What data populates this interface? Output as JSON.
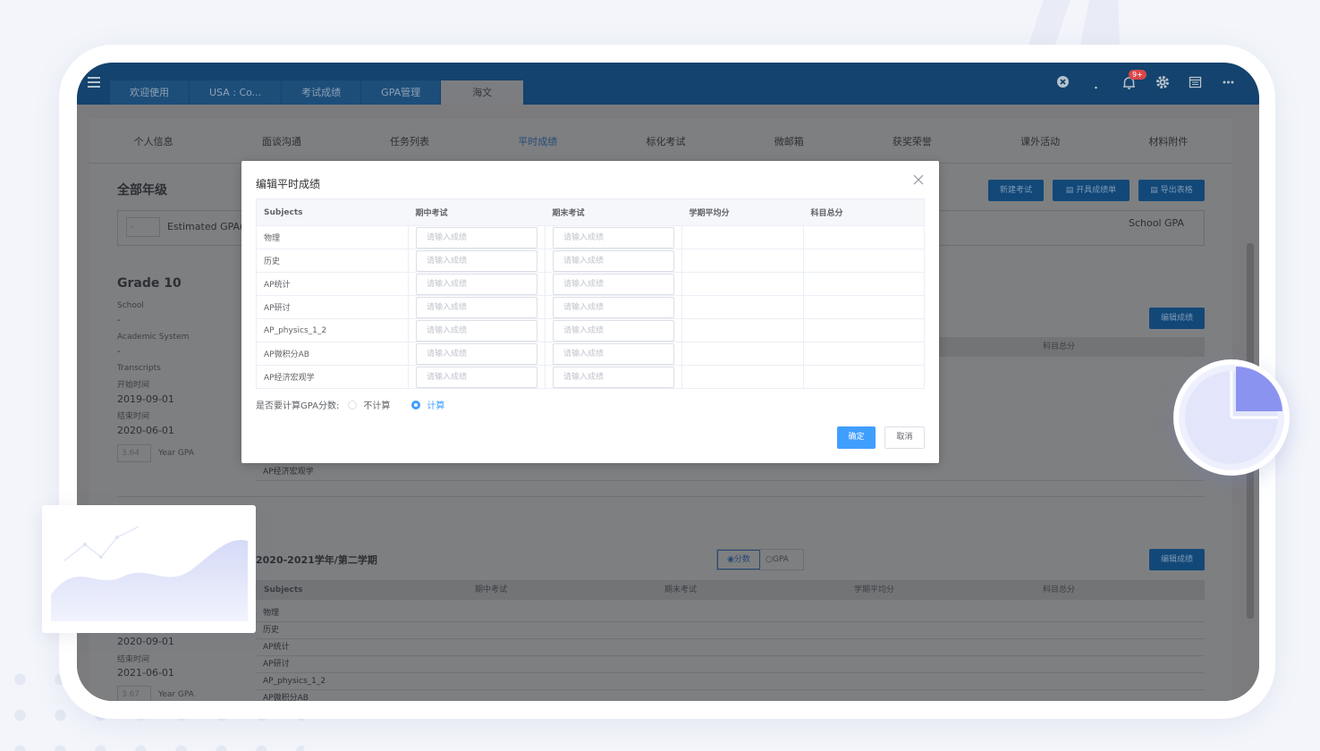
{
  "topbar": {
    "tabs": [
      "欢迎使用",
      "USA : Co...",
      "考试成绩",
      "GPA管理",
      "海文"
    ],
    "active_tab": 4,
    "notification_count": "9+"
  },
  "subnav": {
    "items": [
      "个人信息",
      "面谈沟通",
      "任务列表",
      "平时成绩",
      "标化考试",
      "微邮箱",
      "获奖荣誉",
      "课外活动",
      "材料附件"
    ],
    "active": 3
  },
  "background_page": {
    "all_grades": "全部年级",
    "estimated_gpa": "Estimated GPA(4",
    "estimated_gpa_value": "-",
    "school_gpa": "School GPA",
    "buttons": {
      "new_exam": "新建考试",
      "open_report": "开具成绩单",
      "export": "导出表格",
      "edit_scores": "编辑成绩"
    },
    "grade": "Grade 10",
    "school_label": "School",
    "school_value": "-",
    "academic_label": "Academic System",
    "academic_value": "-",
    "transcripts_label": "Transcripts",
    "start_label": "开始时间",
    "start_value": "2019-09-01",
    "end_label": "结束时间",
    "end_value": "2020-06-01",
    "year_gpa_value": "3.64",
    "year_gpa_label": "Year GPA",
    "col_total": "科目总分",
    "partial_row": "AP经济宏观学",
    "semester2": {
      "title": "2020-2021学年/第二学期",
      "toggle_score": "分数",
      "toggle_gpa": "GPA",
      "edit": "编辑成绩",
      "headers": [
        "Subjects",
        "期中考试",
        "期末考试",
        "学期平均分",
        "科目总分"
      ],
      "rows": [
        "物理",
        "历史",
        "AP统计",
        "AP研讨",
        "AP_physics_1_2",
        "AP微积分AB"
      ],
      "start_value": "2020-09-01",
      "end_label": "结束时间",
      "end_value": "2021-06-01",
      "year_gpa_value": "3.67",
      "year_gpa_label": "Year GPA"
    }
  },
  "modal": {
    "title": "编辑平时成绩",
    "headers": [
      "Subjects",
      "期中考试",
      "期末考试",
      "学期平均分",
      "科目总分"
    ],
    "rows": [
      "物理",
      "历史",
      "AP统计",
      "AP研讨",
      "AP_physics_1_2",
      "AP微积分AB",
      "AP经济宏观学"
    ],
    "input_placeholder": "请输入成绩",
    "gpa_question": "是否要计算GPA分数:",
    "option_no": "不计算",
    "option_yes": "计算",
    "selected_option": "计算",
    "confirm": "确定",
    "cancel": "取消"
  },
  "colors": {
    "topbar": "#13436e",
    "primary": "#409eff",
    "overlay": "#7b7b7d"
  }
}
